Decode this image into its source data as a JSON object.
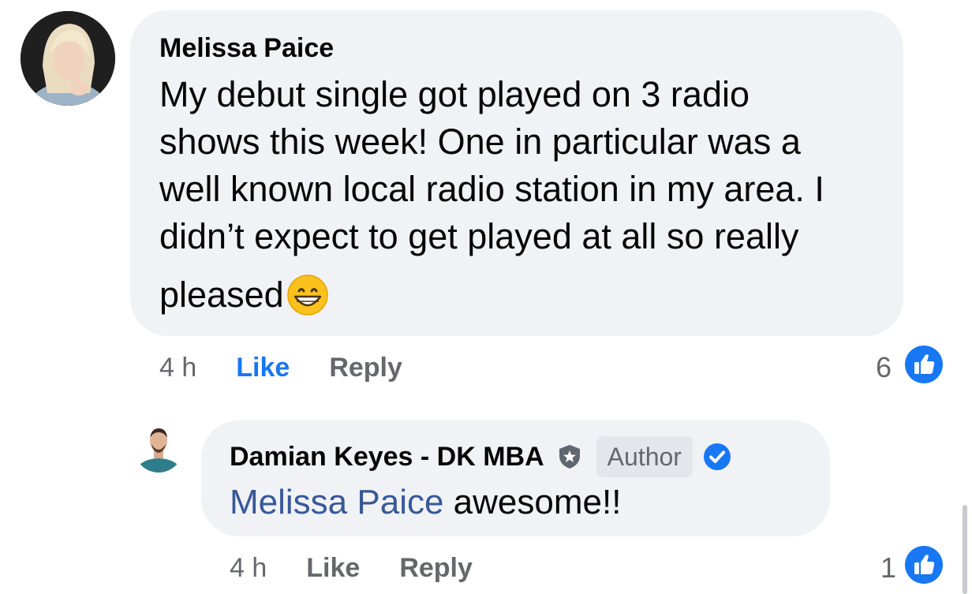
{
  "comment": {
    "author": "Melissa Paice",
    "text_lines": [
      "My debut single got played on 3 radio",
      "shows this week! One in particular was a",
      "well known local radio station in my area. I",
      "didn’t expect to get played at all so really",
      "pleased"
    ],
    "time": "4 h",
    "like_label": "Like",
    "reply_label": "Reply",
    "reaction_count": "6",
    "emoji_icon": "grinning-face-icon",
    "reaction_icon": "thumbs-up-icon"
  },
  "reply": {
    "author": "Damian Keyes - DK MBA",
    "badge_label": "Author",
    "badge_icons": [
      "shield-star-icon",
      "verified-check-icon"
    ],
    "mention": "Melissa Paice",
    "text": "awesome!!",
    "time": "4 h",
    "like_label": "Like",
    "reply_label": "Reply",
    "reaction_count": "1",
    "reaction_icon": "thumbs-up-icon"
  },
  "colors": {
    "accent": "#1877f2",
    "bubble": "#f0f2f5",
    "secondary_text": "#65676b",
    "mention": "#385898"
  }
}
